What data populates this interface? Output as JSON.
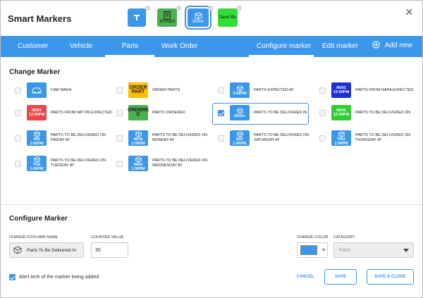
{
  "window": {
    "title": "Smart Markers",
    "close_glyph": "×"
  },
  "quick_access": [
    {
      "text": "",
      "icon": "wrench-icon",
      "color": "#3b97ea"
    },
    {
      "text": "30 Point",
      "icon": "checklist-icon",
      "color": "#4caf50"
    },
    {
      "text": "30min",
      "icon": "box-icon",
      "color": "#3b97ea",
      "selected": true
    },
    {
      "text": "Save Me",
      "icon": "",
      "color": "#33dd33"
    }
  ],
  "tabs": [
    {
      "label": "Customer"
    },
    {
      "label": "Vehicle"
    },
    {
      "label": "Parts",
      "active": true
    },
    {
      "label": "Work Order"
    }
  ],
  "right_tabs": [
    {
      "label": "Configure marker",
      "active": true
    },
    {
      "label": "Edit marker"
    },
    {
      "label": "Add new",
      "icon": "plus-circle-icon"
    }
  ],
  "change_marker": {
    "heading": "Change Marker",
    "markers": [
      {
        "label": "CAR WASH",
        "icon": "car-icon",
        "color": "#3b97ea"
      },
      {
        "label": "ORDER PARTS",
        "icon_text": "ORDER PART",
        "color": "#ffbf00"
      },
      {
        "label": "PARTS EXPECTED AT",
        "icon_text": "3:00PM",
        "icon": "box-icon",
        "color": "#3b97ea"
      },
      {
        "label": "PARTS FROM NAPA EXPECTED",
        "icon_text": "06/01 12:00PM",
        "color": "#1e2fd6"
      },
      {
        "label": "PARTS FROM WP ON EXPECTED",
        "icon_text": "06/01 12:00PM",
        "color": "#e84a4a"
      },
      {
        "label": "PARTS ORDERED",
        "icon_text": "ORDERE D",
        "color": "#4caf50"
      },
      {
        "label": "PARTS TO BE DELIVERED IN",
        "icon_text": "20min",
        "icon": "box-icon",
        "color": "#3b97ea",
        "checked": true
      },
      {
        "label": "PARTS TO BE DELIVERED ON",
        "icon_text": "06/01 12:00PM",
        "color": "#33cc33"
      },
      {
        "label": "PARTS TO BE DELIVERED ON FRIDAY AT",
        "icon_text": "FRI 1:00PM",
        "icon": "box-icon",
        "color": "#3b97ea"
      },
      {
        "label": "PARTS TO BE DELIVERED ON MONDAY AT",
        "icon_text": "MON 1:00PM",
        "icon": "box-icon",
        "color": "#3b97ea"
      },
      {
        "label": "PARTS TO BE DELIVERED ON SATURDAY AT",
        "icon_text": "SAT 1:00PM",
        "icon": "box-icon",
        "color": "#3b97ea"
      },
      {
        "label": "PARTS TO BE DELIVERED ON THURSDAY AT",
        "icon_text": "THU 1:00PM",
        "icon": "box-icon",
        "color": "#3b97ea"
      },
      {
        "label": "PARTS TO BE DELIVERED ON TUESDAY AT",
        "icon_text": "TUE 1:00PM",
        "icon": "box-icon",
        "color": "#3b97ea"
      },
      {
        "label": "PARTS TO BE DELIVERED ON WEDNESDAY AT",
        "icon_text": "WED 1:00PM",
        "icon": "box-icon",
        "color": "#3b97ea"
      }
    ]
  },
  "configure": {
    "heading": "Configure Marker",
    "icon_label": "CHANGE ICON AND NAME",
    "icon_name": "Parts To Be Delivered In",
    "counter_label": "COUNTER VALUE",
    "counter_value": "30",
    "color_label": "CHANGE COLOR",
    "color_value": "#3b97ea",
    "category_label": "CATEGORY",
    "category_value": "Parts"
  },
  "footer": {
    "alert_label": "Alert tech of the marker being added",
    "cancel": "CANCEL",
    "save": "SAVE",
    "save_close": "SAVE & CLOSE"
  }
}
